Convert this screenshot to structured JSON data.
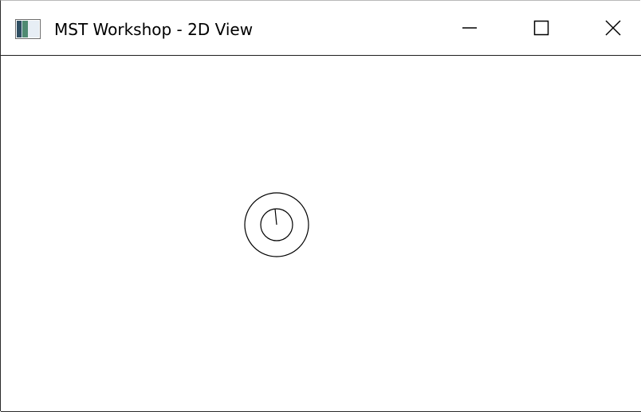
{
  "window": {
    "title": "MST Workshop - 2D View",
    "app_icon": "app-window-icon",
    "controls": {
      "minimize_icon": "minimize-icon",
      "maximize_icon": "maximize-icon",
      "close_icon": "close-icon"
    }
  },
  "view": {
    "background": "#ffffff",
    "stroke_color": "#000000",
    "object": {
      "type": "circular-agent",
      "shapes": [
        "outer-ring",
        "inner-circle",
        "heading-line"
      ]
    }
  }
}
